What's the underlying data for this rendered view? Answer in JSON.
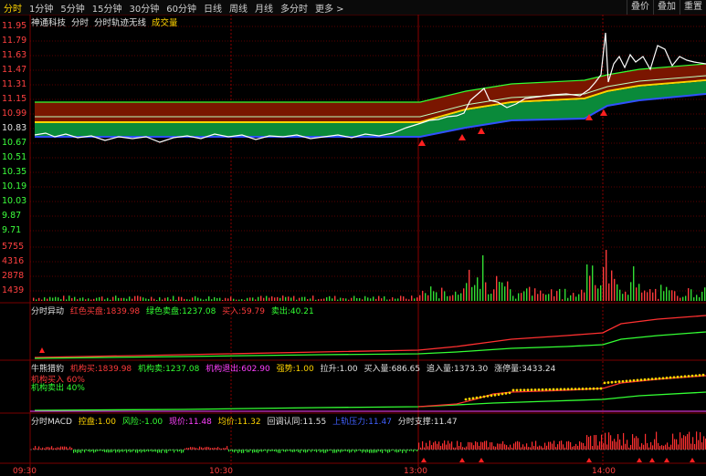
{
  "toolbar": {
    "tabs": [
      "分时",
      "1分钟",
      "5分钟",
      "15分钟",
      "30分钟",
      "60分钟",
      "日线",
      "周线",
      "月线",
      "多分时",
      "更多 >"
    ],
    "right_tabs": [
      "叠价",
      "叠加",
      "重置"
    ]
  },
  "title": {
    "stock_name": "神通科技",
    "mode": "分时",
    "indicator": "分时轨迹无线",
    "volume_label": "成交量"
  },
  "price_axis": [
    "11.95",
    "11.79",
    "11.63",
    "11.47",
    "11.31",
    "11.15",
    "10.99",
    "10.83",
    "10.67",
    "10.51",
    "10.35",
    "10.19",
    "10.03",
    "9.87",
    "9.71"
  ],
  "volume_axis": [
    "5755",
    "4316",
    "2878",
    "1439"
  ],
  "panel1": {
    "name": "分时异动",
    "red_label": "红色买盘:",
    "red_value": "1839.98",
    "green_label": "绿色卖盘:",
    "green_value": "1237.08",
    "buy_label": "买入:",
    "buy_value": "59.79",
    "sell_label": "卖出:",
    "sell_value": "40.21"
  },
  "panel2": {
    "name": "牛熊猎豹",
    "inst_buy_label": "机构买:",
    "inst_buy_value": "1839.98",
    "inst_sell_label": "机构卖:",
    "inst_sell_value": "1237.08",
    "inst_exit_label": "机构退出:",
    "inst_exit_value": "602.90",
    "trend_label": "强势:",
    "trend_value": "1.00",
    "pull_label": "拉升:",
    "pull_value": "1.00",
    "buy_in_label": "买入量:",
    "buy_in_value": "686.65",
    "chase_label": "追入量:",
    "chase_value": "1373.30",
    "rise_label": "涨停量:",
    "rise_value": "3433.24",
    "inst_buy_pct": "机构买入 60%",
    "inst_sell_pct": "机构卖出 40%"
  },
  "panel3": {
    "name": "分时MACD",
    "control_label": "控盘:",
    "control_value": "1.00",
    "risk_label": "风险:",
    "risk_value": "-1.00",
    "price_label": "现价:",
    "price_value": "11.48",
    "avg_label": "均价:",
    "avg_value": "11.32",
    "pullback_label": "回调认同:",
    "pullback_value": "11.55",
    "upper_label": "上轨压力:",
    "upper_value": "11.47",
    "support_label": "分时支撑:",
    "support_value": "11.47"
  },
  "time_axis": [
    "09:30",
    "10:30",
    "13:00",
    "14:00"
  ],
  "colors": {
    "red": "#ff3b3b",
    "green": "#33ff33",
    "yellow": "#ffd400",
    "dark_red": "#7a0c00",
    "band_green": "#0a8a3a",
    "grid": "#6a0000"
  }
}
